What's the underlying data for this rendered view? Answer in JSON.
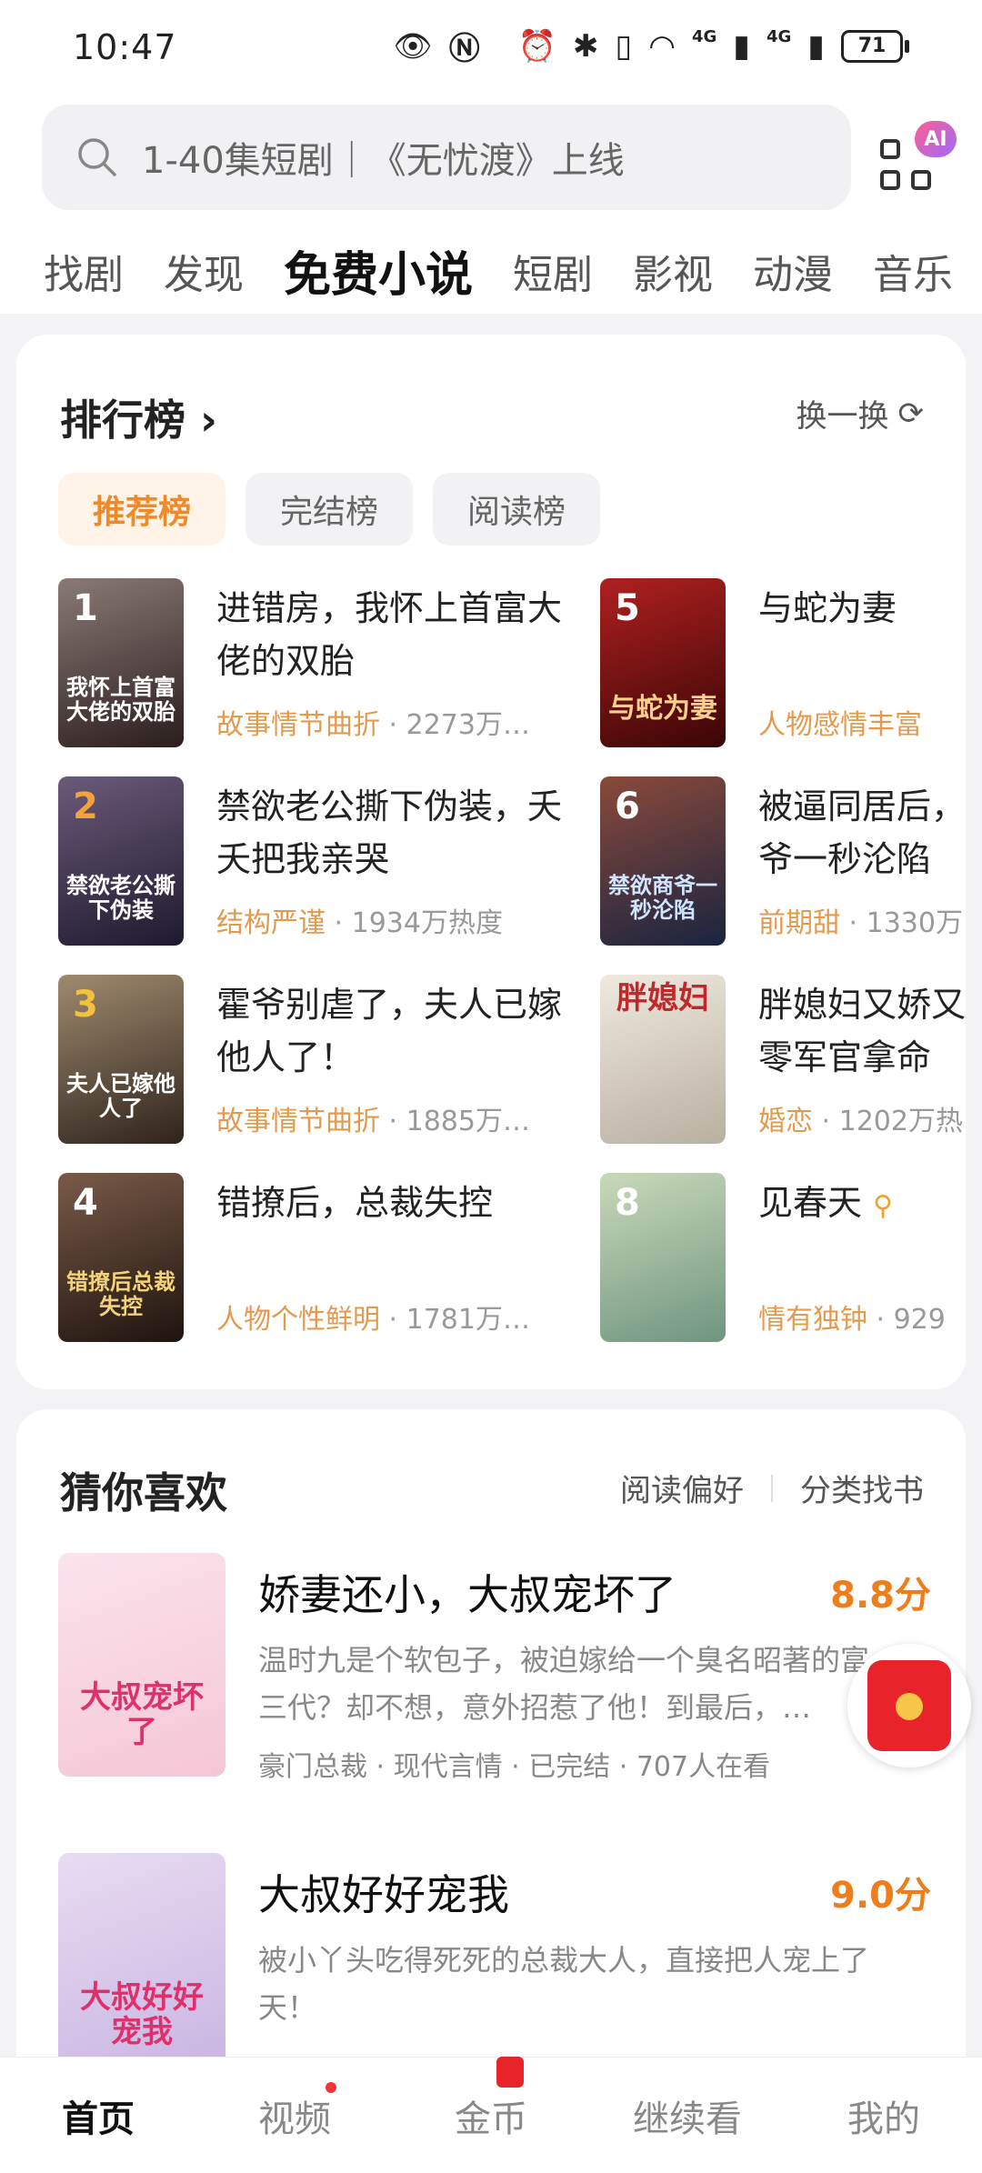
{
  "status": {
    "time": "10:47",
    "battery": "71"
  },
  "search": {
    "placeholder": "1-40集短剧｜《无忧渡》上线",
    "ai_badge": "AI"
  },
  "tabs": [
    "找剧",
    "发现",
    "免费小说",
    "短剧",
    "影视",
    "动漫",
    "音乐"
  ],
  "ranking": {
    "title": "排行榜",
    "refresh": "换一换",
    "subtabs": [
      "推荐榜",
      "完结榜",
      "阅读榜"
    ],
    "items": [
      {
        "rank": "1",
        "title": "进错房，我怀上首富大佬的双胎",
        "cover_text": "我怀上首富大佬的双胎",
        "tag": "故事情节曲折",
        "hot": "· 2273万…",
        "color": "#4a3a3a"
      },
      {
        "rank": "2",
        "title": "禁欲老公撕下伪装，夭夭把我亲哭",
        "cover_text": "禁欲老公撕下伪装",
        "tag": "结构严谨",
        "hot": "· 1934万热度",
        "color": "#3a2f4a"
      },
      {
        "rank": "3",
        "title": "霍爷别虐了，夫人已嫁他人了！",
        "cover_text": "夫人已嫁他人了",
        "tag": "故事情节曲折",
        "hot": "· 1885万…",
        "color": "#4a3f35"
      },
      {
        "rank": "4",
        "title": "错撩后，总裁失控",
        "cover_text": "错撩后总裁失控",
        "tag": "人物个性鲜明",
        "hot": "· 1781万…",
        "color": "#3b2a22"
      },
      {
        "rank": "5",
        "title": "与蛇为妻",
        "cover_text": "与蛇为妻",
        "tag": "人物感情丰富",
        "hot": "",
        "color": "#7a1515"
      },
      {
        "rank": "6",
        "title": "被逼同居后，爷一秒沦陷",
        "cover_text": "禁欲商爷一秒沦陷",
        "tag": "前期甜",
        "hot": "· 1330万",
        "color": "#2a3550"
      },
      {
        "rank": "7",
        "title": "胖媳妇又娇又零军官拿命",
        "cover_text": "胖媳妇",
        "tag": "婚恋",
        "hot": "· 1202万热",
        "color": "#d9d3c8"
      },
      {
        "rank": "8",
        "title": "见春天",
        "cover_text": "",
        "tag": "情有独钟",
        "hot": "· 929",
        "color": "#9fb8a2"
      }
    ]
  },
  "guess": {
    "title": "猜你喜欢",
    "link_pref": "阅读偏好",
    "link_cat": "分类找书",
    "books": [
      {
        "title": "娇妻还小，大叔宠坏了",
        "score": "8.8分",
        "cover_text": "大叔宠坏了",
        "desc": "温时九是个软包子，被迫嫁给一个臭名昭著的富三代？却不想，意外招惹了他！到最后，…",
        "tags": "豪门总裁 · 现代言情 · 已完结 · 707人在看"
      },
      {
        "title": "大叔好好宠我",
        "score": "9.0分",
        "cover_text": "大叔好好宠我",
        "desc": "被小丫头吃得死死的总裁大人，直接把人宠上了天！",
        "tags": ""
      }
    ]
  },
  "nav": [
    "首页",
    "视频",
    "金币",
    "继续看",
    "我的"
  ]
}
